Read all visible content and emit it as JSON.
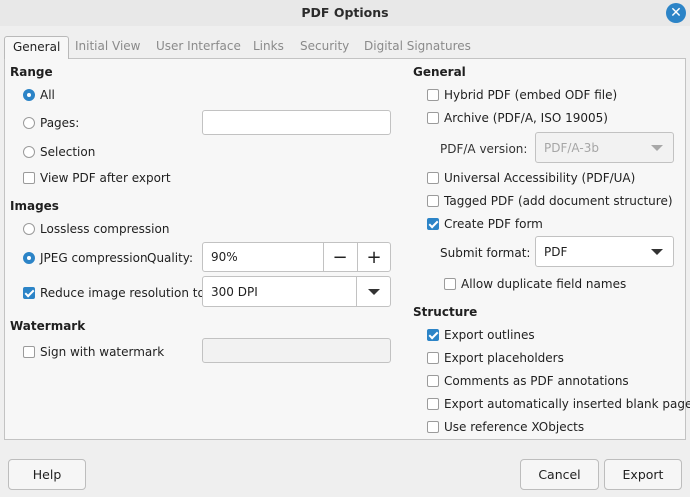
{
  "window": {
    "title": "PDF Options"
  },
  "tabs": [
    "General",
    "Initial View",
    "User Interface",
    "Links",
    "Security",
    "Digital Signatures"
  ],
  "range": {
    "title": "Range",
    "all": "All",
    "pages": "Pages:",
    "pages_value": "",
    "selection": "Selection",
    "view_pdf": "View PDF after export"
  },
  "images": {
    "title": "Images",
    "lossless": "Lossless compression",
    "jpeg": "JPEG compression",
    "quality_label": "Quality:",
    "quality_value": "90%",
    "minus": "−",
    "plus": "+",
    "reduce": "Reduce image resolution to:",
    "resolution": "300 DPI"
  },
  "watermark": {
    "title": "Watermark",
    "sign": "Sign with watermark",
    "value": ""
  },
  "general": {
    "title": "General",
    "hybrid": "Hybrid PDF (embed ODF file)",
    "archive": "Archive (PDF/A, ISO 19005)",
    "pdfa_label": "PDF/A version:",
    "pdfa_value": "PDF/A-3b",
    "universal": "Universal Accessibility (PDF/UA)",
    "tagged": "Tagged PDF (add document structure)",
    "create_form": "Create PDF form",
    "submit_label": "Submit format:",
    "submit_value": "PDF",
    "allow_dup": "Allow duplicate field names"
  },
  "structure": {
    "title": "Structure",
    "outlines": "Export outlines",
    "placeholders": "Export placeholders",
    "comments": "Comments as PDF annotations",
    "blank_pages": "Export automatically inserted blank pages",
    "xobjects": "Use reference XObjects"
  },
  "buttons": {
    "help": "Help",
    "cancel": "Cancel",
    "export": "Export"
  },
  "colors": {
    "accent": "#2c84c7"
  }
}
